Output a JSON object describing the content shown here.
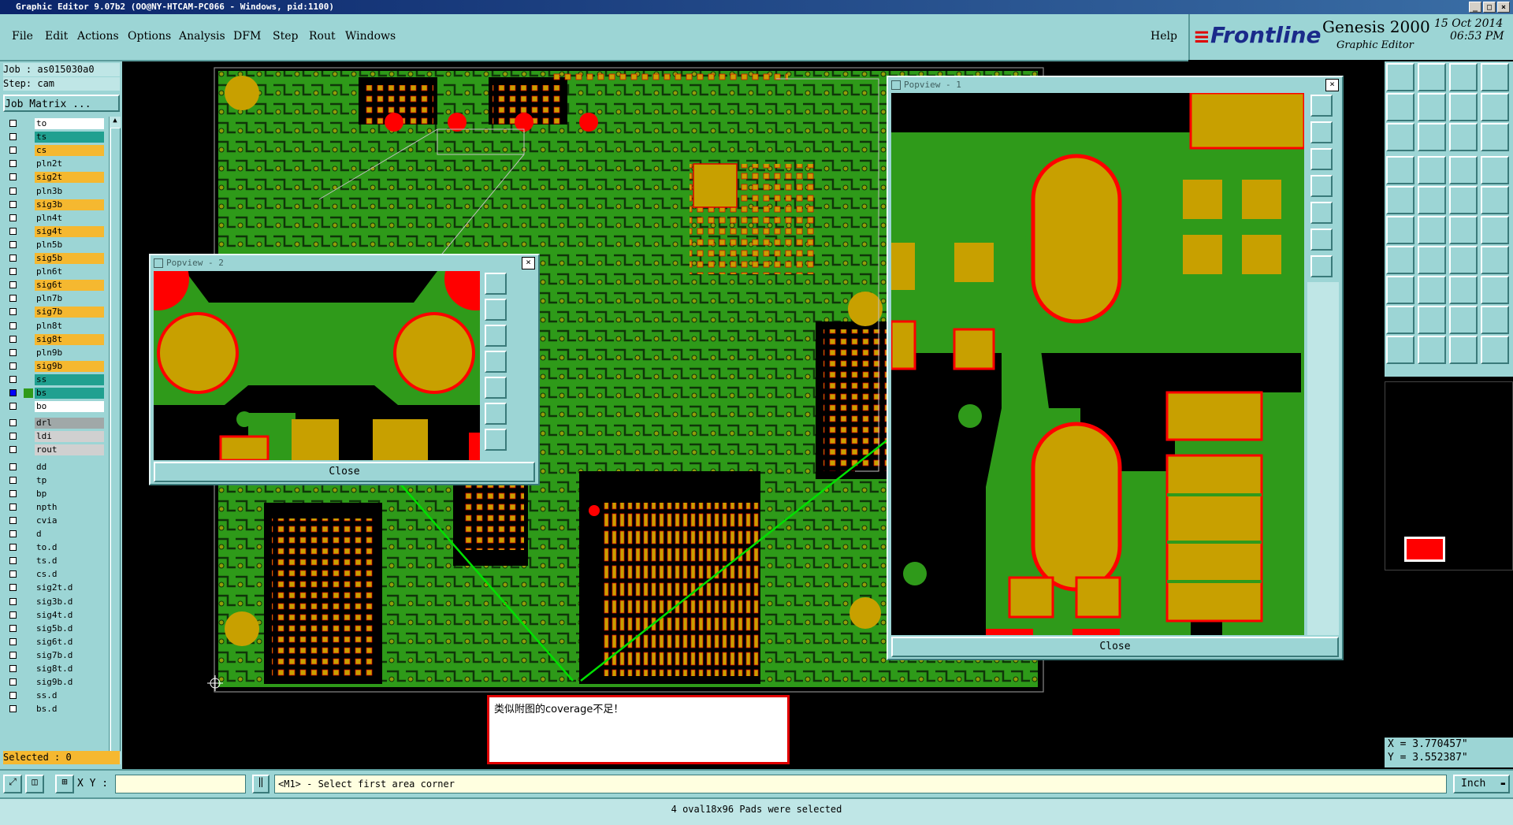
{
  "window": {
    "title": "Graphic Editor 9.07b2 (OO@NY-HTCAM-PC066 - Windows, pid:1100)"
  },
  "menu": {
    "items": [
      "File",
      "Edit",
      "Actions",
      "Options",
      "Analysis",
      "DFM",
      "Step",
      "Rout",
      "Windows"
    ],
    "help": "Help"
  },
  "brand": {
    "logo": "Frontline",
    "product": "Genesis 2000",
    "subtitle": "Graphic Editor",
    "date": "15 Oct 2014",
    "time": "06:53 PM"
  },
  "job": {
    "job_line": "Job : as015030a0",
    "step_line": "Step: cam",
    "matrix_button": "Job Matrix ..."
  },
  "layers": [
    {
      "name": "to",
      "color": "#ffffff",
      "checked": false
    },
    {
      "name": "ts",
      "color": "#20a090",
      "checked": false
    },
    {
      "name": "cs",
      "color": "#f5b830",
      "checked": false
    },
    {
      "name": "pln2t",
      "color": "#9cd5d5",
      "checked": false
    },
    {
      "name": "sig2t",
      "color": "#f5b830",
      "checked": false
    },
    {
      "name": "pln3b",
      "color": "#9cd5d5",
      "checked": false
    },
    {
      "name": "sig3b",
      "color": "#f5b830",
      "checked": false
    },
    {
      "name": "pln4t",
      "color": "#9cd5d5",
      "checked": false
    },
    {
      "name": "sig4t",
      "color": "#f5b830",
      "checked": false
    },
    {
      "name": "pln5b",
      "color": "#9cd5d5",
      "checked": false
    },
    {
      "name": "sig5b",
      "color": "#f5b830",
      "checked": false
    },
    {
      "name": "pln6t",
      "color": "#9cd5d5",
      "checked": false
    },
    {
      "name": "sig6t",
      "color": "#f5b830",
      "checked": false
    },
    {
      "name": "pln7b",
      "color": "#9cd5d5",
      "checked": false
    },
    {
      "name": "sig7b",
      "color": "#f5b830",
      "checked": false
    },
    {
      "name": "pln8t",
      "color": "#9cd5d5",
      "checked": false
    },
    {
      "name": "sig8t",
      "color": "#f5b830",
      "checked": false
    },
    {
      "name": "pln9b",
      "color": "#9cd5d5",
      "checked": false
    },
    {
      "name": "sig9b",
      "color": "#f5b830",
      "checked": false
    },
    {
      "name": "ss",
      "color": "#20a090",
      "checked": false
    },
    {
      "name": "bs",
      "color": "#20a090",
      "checked": true
    },
    {
      "name": "bo",
      "color": "#ffffff",
      "checked": false
    },
    {
      "name": "drl",
      "color": "#a0a8a8",
      "checked": false
    },
    {
      "name": "ldi",
      "color": "#d0d0d0",
      "checked": false
    },
    {
      "name": "rout",
      "color": "#d0d0d0",
      "checked": false
    },
    {
      "name": "dd",
      "color": "#9cd5d5",
      "checked": false
    },
    {
      "name": "tp",
      "color": "#9cd5d5",
      "checked": false
    },
    {
      "name": "bp",
      "color": "#9cd5d5",
      "checked": false
    },
    {
      "name": "npth",
      "color": "#9cd5d5",
      "checked": false
    },
    {
      "name": "cvia",
      "color": "#9cd5d5",
      "checked": false
    },
    {
      "name": "d",
      "color": "#9cd5d5",
      "checked": false
    },
    {
      "name": "to.d",
      "color": "#9cd5d5",
      "checked": false
    },
    {
      "name": "ts.d",
      "color": "#9cd5d5",
      "checked": false
    },
    {
      "name": "cs.d",
      "color": "#9cd5d5",
      "checked": false
    },
    {
      "name": "sig2t.d",
      "color": "#9cd5d5",
      "checked": false
    },
    {
      "name": "sig3b.d",
      "color": "#9cd5d5",
      "checked": false
    },
    {
      "name": "sig4t.d",
      "color": "#9cd5d5",
      "checked": false
    },
    {
      "name": "sig5b.d",
      "color": "#9cd5d5",
      "checked": false
    },
    {
      "name": "sig6t.d",
      "color": "#9cd5d5",
      "checked": false
    },
    {
      "name": "sig7b.d",
      "color": "#9cd5d5",
      "checked": false
    },
    {
      "name": "sig8t.d",
      "color": "#9cd5d5",
      "checked": false
    },
    {
      "name": "sig9b.d",
      "color": "#9cd5d5",
      "checked": false
    },
    {
      "name": "ss.d",
      "color": "#9cd5d5",
      "checked": false
    },
    {
      "name": "bs.d",
      "color": "#9cd5d5",
      "checked": false
    }
  ],
  "selected": "Selected : 0",
  "popup2": {
    "title": "Popview - 2",
    "close": "Close"
  },
  "popup1": {
    "title": "Popview - 1",
    "close": "Close"
  },
  "annotation": "类似附图的coverage不足！",
  "coords": {
    "x": "X = 3.770457\"",
    "y": "Y = 3.552387\""
  },
  "statusbar": {
    "xy_label": "X Y :",
    "xy_value": "",
    "prompt": "<M1> - Select first area corner",
    "units": "Inch"
  },
  "message": "4 oval18x96 Pads were selected",
  "colors": {
    "board_green": "#2f9a1a",
    "pad_gold": "#c8a000",
    "highlight_red": "#ff0000",
    "ui_teal": "#9cd5d5",
    "arrow": "#00e000"
  }
}
